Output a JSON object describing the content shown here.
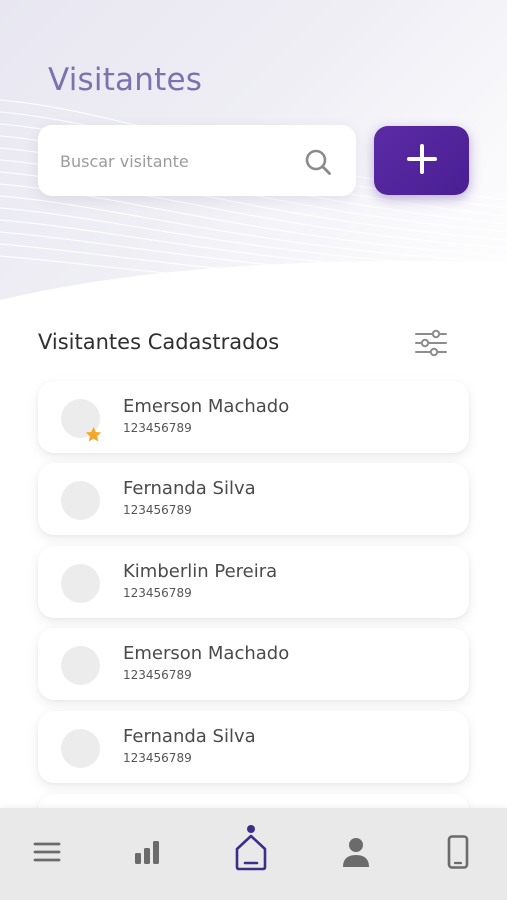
{
  "header": {
    "title": "Visitantes"
  },
  "search": {
    "placeholder": "Buscar visitante",
    "icon": "search-icon"
  },
  "actions": {
    "add_icon": "plus-icon",
    "accent": "#4f22a0"
  },
  "list": {
    "title": "Visitantes Cadastrados",
    "filter_icon": "sliders-icon",
    "items": [
      {
        "name": "Emerson Machado",
        "phone": "123456789",
        "favorite": true
      },
      {
        "name": "Fernanda Silva",
        "phone": "123456789",
        "favorite": false
      },
      {
        "name": "Kimberlin Pereira",
        "phone": "123456789",
        "favorite": false
      },
      {
        "name": "Emerson Machado",
        "phone": "123456789",
        "favorite": false
      },
      {
        "name": "Fernanda Silva",
        "phone": "123456789",
        "favorite": false
      }
    ]
  },
  "bottom_nav": {
    "items": [
      {
        "icon": "menu-icon",
        "active": false
      },
      {
        "icon": "bar-chart-icon",
        "active": false
      },
      {
        "icon": "home-icon",
        "active": true
      },
      {
        "icon": "user-icon",
        "active": false
      },
      {
        "icon": "phone-icon",
        "active": false
      }
    ],
    "active_color": "#3b2f8a",
    "inactive_color": "#6b6b6b",
    "favorite_color": "#f0a92b"
  }
}
